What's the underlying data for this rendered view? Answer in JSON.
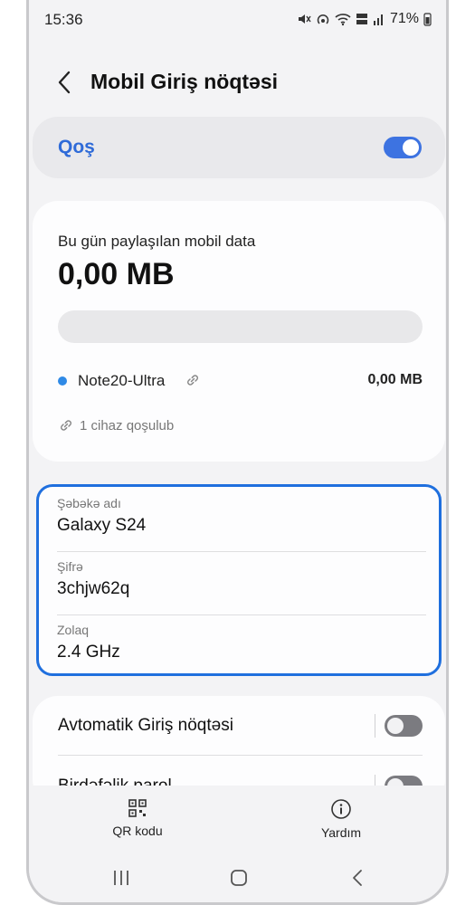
{
  "status": {
    "time": "15:36",
    "battery": "71%",
    "icons": [
      "mute-icon",
      "hotspot-icon",
      "wifi-icon",
      "volte-icon",
      "signal-icon"
    ]
  },
  "header": {
    "title": "Mobil Giriş nöqtəsi",
    "back_icon": "chevron-left-icon"
  },
  "master_toggle": {
    "label": "Qoş",
    "state": "on"
  },
  "usage": {
    "subtitle": "Bu gün paylaşılan mobil data",
    "amount": "0,00 MB",
    "progress_fraction": 0,
    "device": {
      "name": "Note20-Ultra",
      "usage": "0,00 MB"
    },
    "connected_text": "1 cihaz qoşulub"
  },
  "network": {
    "rows": [
      {
        "label": "Şəbəkə adı",
        "value": "Galaxy S24"
      },
      {
        "label": "Şifrə",
        "value": "3chjw62q"
      },
      {
        "label": "Zolaq",
        "value": "2.4 GHz"
      }
    ]
  },
  "options": [
    {
      "label": "Avtomatik Giriş nöqtəsi",
      "state": "off"
    },
    {
      "label": "Birdəfəlik parol",
      "state": "off"
    }
  ],
  "bottom_actions": {
    "qr_label": "QR kodu",
    "help_label": "Yardım"
  },
  "colors": {
    "accent": "#3d73e1",
    "highlight_border": "#1f6fde",
    "device_dot": "#2f8ae6"
  }
}
